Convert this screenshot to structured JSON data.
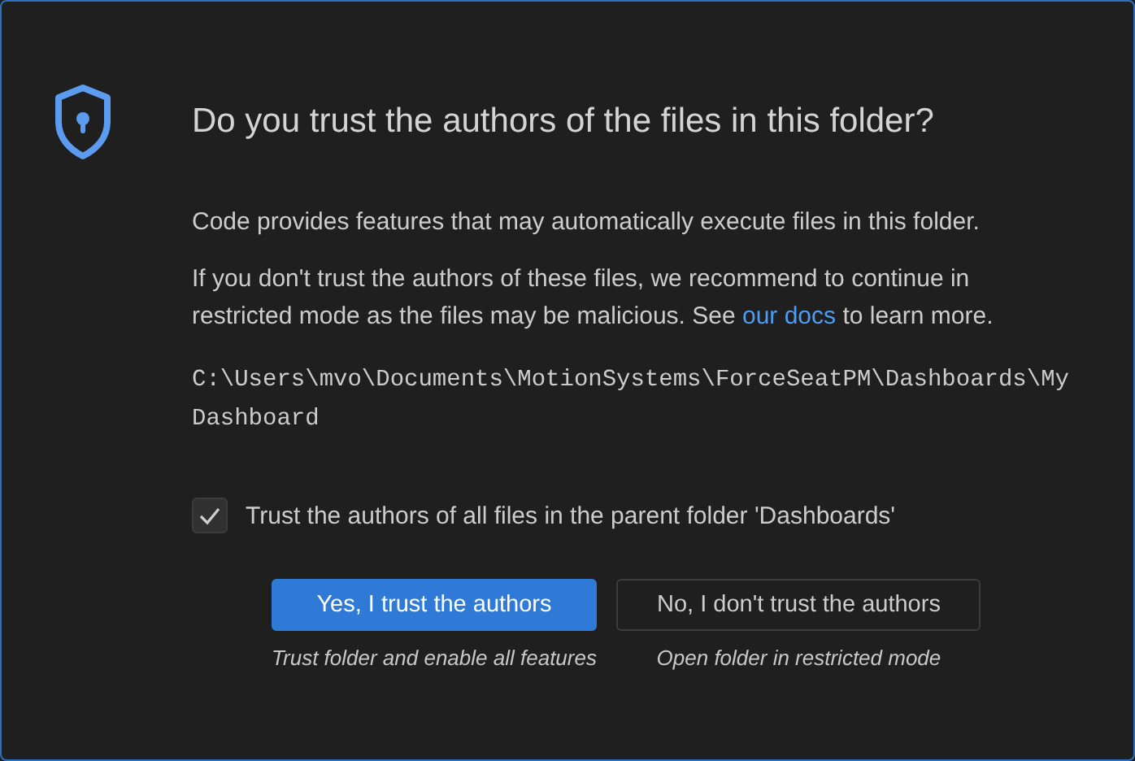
{
  "dialog": {
    "title": "Do you trust the authors of the files in this folder?",
    "paragraphs": [
      "Code provides features that may automatically execute files in this folder."
    ],
    "warning": {
      "before": "If you don't trust the authors of these files, we recommend to continue in restricted mode as the files may be malicious. See ",
      "link": "our docs",
      "after": " to learn more."
    },
    "path": "C:\\Users\\mvo\\Documents\\MotionSystems\\ForceSeatPM\\Dashboards\\My Dashboard",
    "checkbox": {
      "label": "Trust the authors of all files in the parent folder 'Dashboards'",
      "checked": true
    },
    "buttons": [
      {
        "label": "Yes, I trust the authors",
        "caption": "Trust folder and enable all features",
        "primary": true
      },
      {
        "label": "No, I don't trust the authors",
        "caption": "Open folder in restricted mode",
        "primary": false
      }
    ]
  }
}
